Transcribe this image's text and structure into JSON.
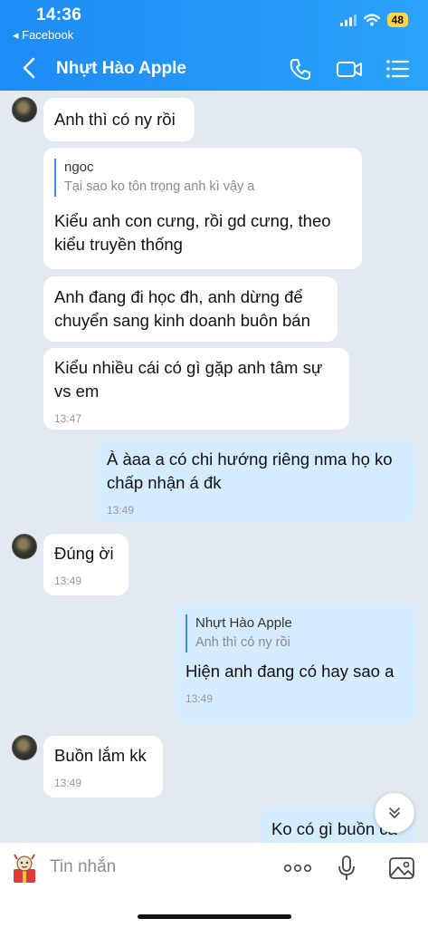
{
  "status_bar": {
    "time": "14:36",
    "back_app": "◂ Facebook",
    "battery": "48"
  },
  "header": {
    "title": "Nhựt Hào Apple"
  },
  "messages": [
    {
      "text": "Anh thì có ny rồi"
    },
    {
      "quote_name": "ngoc",
      "quote_text": "Tại sao ko tôn trọng anh kì vậy a",
      "text": "Kiểu anh con cưng, rồi gd cưng, theo kiểu truyền thống"
    },
    {
      "text": "Anh đang đi học đh, anh dừng để chuyển sang kinh doanh buôn bán"
    },
    {
      "text": "Kiểu nhiều cái có gì gặp anh tâm sự vs em",
      "time": "13:47"
    },
    {
      "text": "À àaa a có chi hướng riêng nma họ ko chấp nhận á đk",
      "time": "13:49"
    },
    {
      "text": "Đúng ời",
      "time": "13:49"
    },
    {
      "quote_name": "Nhựt Hào Apple",
      "quote_text": "Anh thì có ny rồi",
      "text": "Hiện anh đang có hay sao a",
      "time": "13:49"
    },
    {
      "text": "Buồn lắm kk",
      "time": "13:49"
    },
    {
      "text": "Ko có gì buồn cả"
    }
  ],
  "composer": {
    "placeholder": "Tin nhắn"
  },
  "colors": {
    "header": "#1d8cf5",
    "outgoing": "#d4ecfd",
    "incoming": "#ffffff",
    "background": "#e2e9f1"
  }
}
